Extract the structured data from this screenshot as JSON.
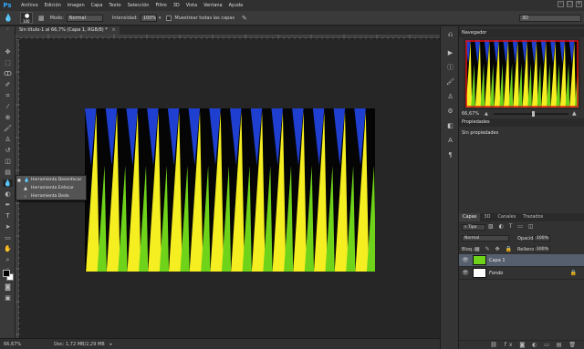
{
  "app": {
    "logo": "Ps",
    "menu": [
      "Archivo",
      "Edición",
      "Imagen",
      "Capa",
      "Texto",
      "Selección",
      "Filtro",
      "3D",
      "Vista",
      "Ventana",
      "Ayuda"
    ]
  },
  "options": {
    "brush_size": "100",
    "mode_label": "Modo:",
    "mode_value": "Normal",
    "intensity_label": "Intensidad:",
    "intensity_value": "100%",
    "sample_all_label": "Muestrear todas las capas",
    "workspace": "3D"
  },
  "document": {
    "tab_title": "Sin título-1 al 66,7% (Capa 1, RGB/8) *"
  },
  "flyout": {
    "items": [
      "Herramienta Desenfocar",
      "Herramienta Enfocar",
      "Herramienta Dedo"
    ]
  },
  "status": {
    "zoom": "66,67%",
    "doc_info": "Doc: 1,72 MB/2,29 MB"
  },
  "navigator": {
    "title": "Navegador",
    "zoom": "66,67%"
  },
  "properties": {
    "title": "Propiedades",
    "empty_text": "Sin propiedades"
  },
  "layers_panel": {
    "tabs": [
      "Capas",
      "3D",
      "Canales",
      "Trazados"
    ],
    "kind_filter": "Tipo",
    "blend_mode": "Normal",
    "opacity_label": "Opacidad:",
    "opacity_value": "100%",
    "lock_label": "Bloq.:",
    "fill_label": "Relleno:",
    "fill_value": "100%",
    "layers": [
      {
        "name": "Capa 1",
        "selected": true
      },
      {
        "name": "Fondo",
        "selected": false
      }
    ]
  },
  "artwork": {
    "colors": {
      "blue": "#1f3fd0",
      "black": "#050505",
      "yellow": "#f5ee20",
      "green": "#6fd31a",
      "red": "#e01010"
    }
  }
}
